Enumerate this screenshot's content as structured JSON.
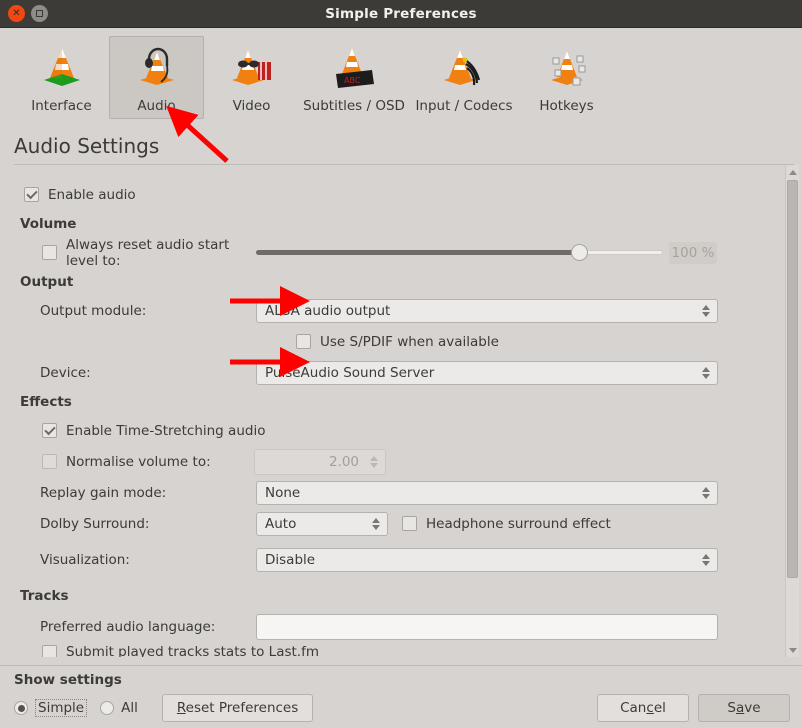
{
  "window": {
    "title": "Simple Preferences",
    "close_icon": "close-icon",
    "maximize_icon": "maximize-icon"
  },
  "toolbar": {
    "items": [
      {
        "label": "Interface",
        "icon": "vlc-cone-interface-icon",
        "selected": false
      },
      {
        "label": "Audio",
        "icon": "vlc-cone-headphones-icon",
        "selected": true
      },
      {
        "label": "Video",
        "icon": "vlc-cone-video-icon",
        "selected": false
      },
      {
        "label": "Subtitles / OSD",
        "icon": "vlc-cone-subtitles-icon",
        "selected": false
      },
      {
        "label": "Input / Codecs",
        "icon": "vlc-cone-cables-icon",
        "selected": false
      },
      {
        "label": "Hotkeys",
        "icon": "vlc-cone-keys-icon",
        "selected": false
      }
    ]
  },
  "page": {
    "title": "Audio Settings",
    "enable_audio": {
      "label": "Enable audio",
      "checked": true
    },
    "groups": {
      "volume": {
        "header": "Volume",
        "always_reset": {
          "label": "Always reset audio start level to:",
          "checked": false
        },
        "slider": {
          "value": 100,
          "min": 0,
          "max": 125,
          "display": "100 %"
        }
      },
      "output": {
        "header": "Output",
        "output_module": {
          "label": "Output module:",
          "value": "ALSA audio output"
        },
        "spdif": {
          "label": "Use S/PDIF when available",
          "checked": false
        },
        "device": {
          "label": "Device:",
          "value": "PulseAudio Sound Server"
        }
      },
      "effects": {
        "header": "Effects",
        "time_stretch": {
          "label": "Enable Time-Stretching audio",
          "checked": true
        },
        "normalise": {
          "label": "Normalise volume to:",
          "checked": false,
          "value": "2.00"
        },
        "replay_gain": {
          "label": "Replay gain mode:",
          "value": "None"
        },
        "dolby": {
          "label": "Dolby Surround:",
          "value": "Auto"
        },
        "headphone": {
          "label": "Headphone surround effect",
          "checked": false
        },
        "visualization": {
          "label": "Visualization:",
          "value": "Disable"
        }
      },
      "tracks": {
        "header": "Tracks",
        "preferred_language": {
          "label": "Preferred audio language:",
          "value": ""
        },
        "lastfm": {
          "label": "Submit played tracks stats to Last.fm",
          "checked": false
        }
      }
    }
  },
  "footer": {
    "show_settings_label": "Show settings",
    "simple_label": "Simple",
    "all_label": "All",
    "selected_mode": "Simple",
    "reset_label": "Reset Preferences",
    "cancel_label": "Cancel",
    "save_label": "Save"
  },
  "annotations": {
    "accent_color": "#ff0000",
    "arrows": [
      {
        "name": "arrow-to-audio-tab",
        "points_to": "Audio"
      },
      {
        "name": "arrow-to-output-module",
        "points_to": "Output module combo"
      },
      {
        "name": "arrow-to-device",
        "points_to": "Device combo"
      }
    ]
  },
  "colors": {
    "window_bg": "#d6d3d0",
    "titlebar_bg": "#3c3b37",
    "text": "#3c3b37",
    "close_button": "#f04713",
    "annotation_red": "#ff0000"
  }
}
